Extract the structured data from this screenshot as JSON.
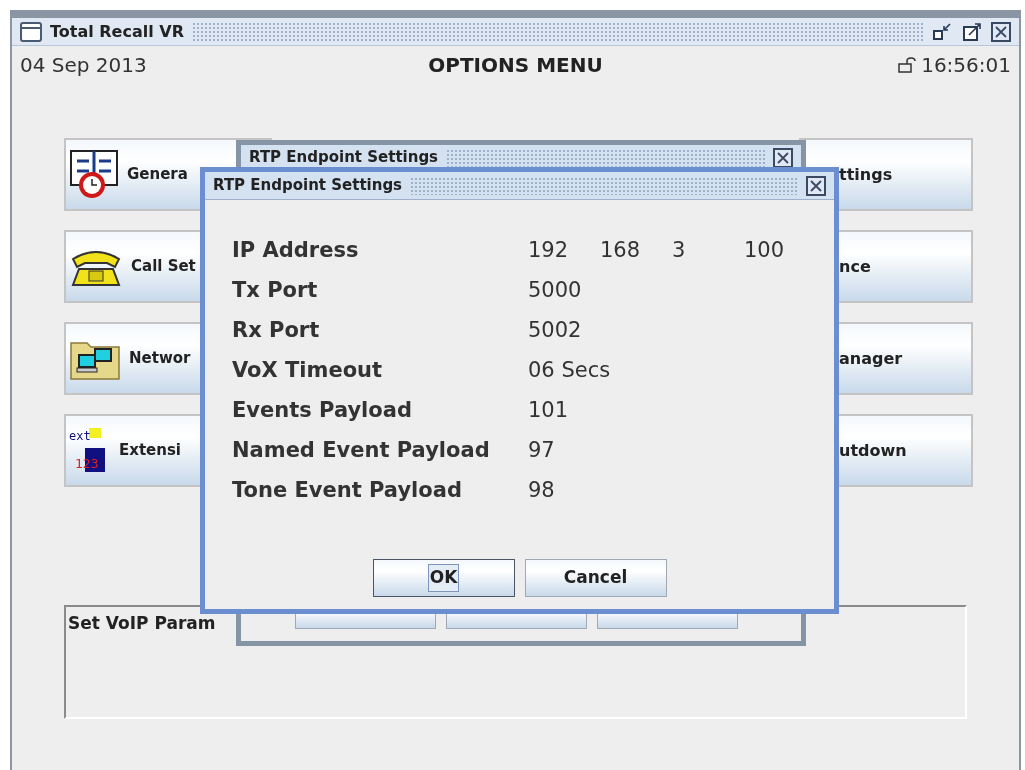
{
  "window": {
    "title": "Total Recall VR"
  },
  "header": {
    "date": "04 Sep 2013",
    "title": "OPTIONS MENU",
    "time": "16:56:01"
  },
  "left_buttons": [
    {
      "label": "Genera",
      "kind": "calendar"
    },
    {
      "label": "Call Set",
      "kind": "phone"
    },
    {
      "label": "Networ",
      "kind": "network"
    },
    {
      "label": "Extensi",
      "kind": "extension",
      "icon_text": [
        "ext",
        "123"
      ]
    }
  ],
  "right_buttons": [
    {
      "label": "ttings"
    },
    {
      "label": "nce"
    },
    {
      "label": "anager"
    },
    {
      "label": "utdown"
    }
  ],
  "status_panel": {
    "text": "Set VoIP Param"
  },
  "back_dialog": {
    "title": "RTP Endpoint Settings"
  },
  "dialog": {
    "title": "RTP Endpoint Settings",
    "fields": [
      {
        "label": "IP Address",
        "values": [
          "192",
          "168",
          "3",
          "100"
        ]
      },
      {
        "label": "Tx Port",
        "values": [
          "5000"
        ]
      },
      {
        "label": "Rx Port",
        "values": [
          "5002"
        ]
      },
      {
        "label": "VoX Timeout",
        "values": [
          "06 Secs"
        ]
      },
      {
        "label": "Events Payload",
        "values": [
          "101"
        ]
      },
      {
        "label": "Named Event Payload",
        "values": [
          "97"
        ]
      },
      {
        "label": "Tone Event Payload",
        "values": [
          "98"
        ]
      }
    ],
    "buttons": [
      {
        "label": "OK",
        "focused": true
      },
      {
        "label": "Cancel",
        "focused": false
      }
    ]
  }
}
